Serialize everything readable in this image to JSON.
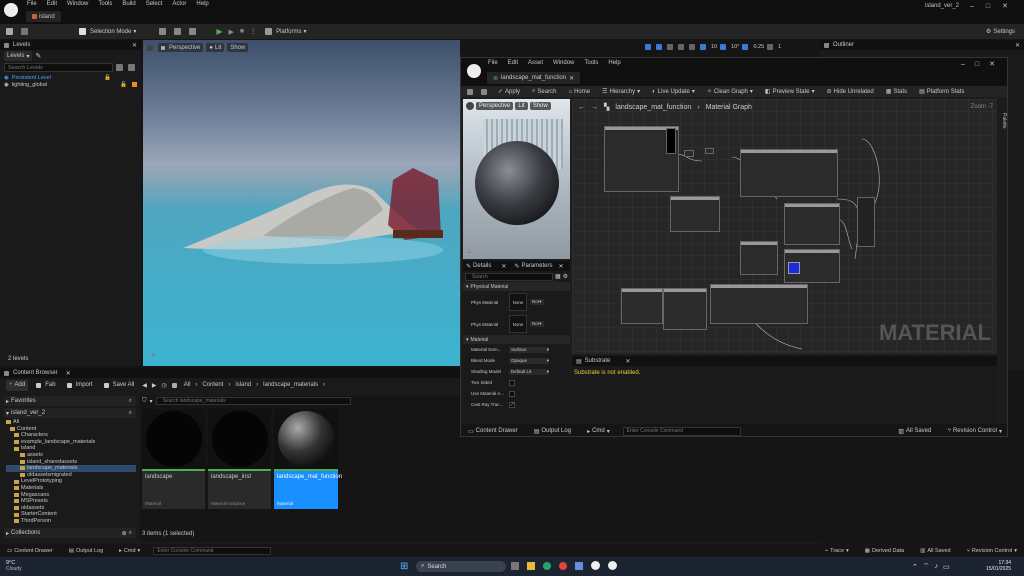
{
  "editor": {
    "menu": [
      "File",
      "Edit",
      "Window",
      "Tools",
      "Build",
      "Select",
      "Actor",
      "Help"
    ],
    "doc_tab": "island",
    "project_name": "island_ver_2",
    "toolbar": {
      "selection_mode": "Selection Mode",
      "platforms": "Platforms",
      "settings": "Settings"
    }
  },
  "levels": {
    "tab": "Levels",
    "dropdown": "Levels",
    "search_placeholder": "Search Levels",
    "items": [
      "Persistent Level",
      "lighting_global"
    ],
    "count": "2 levels"
  },
  "viewport": {
    "perspective": "Perspective",
    "lit": "Lit",
    "show": "Show",
    "grid": "10",
    "angle": "10°",
    "scale": "0.25",
    "cam": "1"
  },
  "outliner": {
    "tab": "Outliner"
  },
  "content_browser": {
    "tab": "Content Browser",
    "add": "Add",
    "fab": "Fab",
    "import": "Import",
    "save_all": "Save All",
    "breadcrumb": [
      "All",
      "Content",
      "island",
      "landscape_materials"
    ],
    "search_placeholder": "Search landscape_materials",
    "favorites": "Favorites",
    "project": "island_ver_2",
    "tree": [
      "All",
      "Content",
      "Characters",
      "example_landscape_materials",
      "island",
      "assets",
      "island_sharedassets",
      "landscape_materials",
      "oldassetsmigrated",
      "LevelPrototyping",
      "Materials",
      "Megascans",
      "MSPresets",
      "oldassets",
      "StarterContent",
      "ThirdPerson"
    ],
    "assets": [
      {
        "name": "landscape",
        "type": "Material"
      },
      {
        "name": "landscape_inst",
        "type": "Material Instance"
      },
      {
        "name": "landscape_mat_function",
        "type": "Material"
      }
    ],
    "status": "3 items (1 selected)",
    "collections": "Collections"
  },
  "material_editor": {
    "menu": [
      "File",
      "Edit",
      "Asset",
      "Window",
      "Tools",
      "Help"
    ],
    "tab": "landscape_mat_function",
    "toolbar": [
      "Apply",
      "Search",
      "Home",
      "Hierarchy",
      "Live Update",
      "Clean Graph",
      "Preview State",
      "Hide Unrelated",
      "Stats",
      "Platform Stats"
    ],
    "graph_breadcrumb": [
      "landscape_mat_function",
      "Material Graph"
    ],
    "zoom": "Zoom -7",
    "watermark": "MATERIAL",
    "palette": "Palette",
    "preview": {
      "perspective": "Perspective",
      "lit": "Lit",
      "show": "Show"
    },
    "details_tabs": [
      "Details",
      "Parameters"
    ],
    "search_placeholder": "Search",
    "physical_section": "Physical Material",
    "phys_rows": [
      {
        "label": "Phys Material",
        "value": "None",
        "drop": "Nor"
      },
      {
        "label": "Phys Material",
        "value": "None",
        "drop": "Nor"
      }
    ],
    "material_section": "Material",
    "mat_rows": [
      {
        "label": "Material Dom...",
        "value": "Surface"
      },
      {
        "label": "Blend Mode",
        "value": "Opaque"
      },
      {
        "label": "Shading Model",
        "value": "Default Lit"
      },
      {
        "label": "Two Sided",
        "value": ""
      },
      {
        "label": "Use Material A...",
        "value": ""
      },
      {
        "label": "Cast Ray Trac...",
        "value": ""
      }
    ],
    "substrate_tab": "Substrate",
    "substrate_msg": "Substrate is not enabled.",
    "bottom": {
      "content_drawer": "Content Drawer",
      "output_log": "Output Log",
      "cmd": "Cmd",
      "console_placeholder": "Enter Console Command",
      "all_saved": "All Saved",
      "revision": "Revision Control"
    }
  },
  "bottom_bar": {
    "content_drawer": "Content Drawer",
    "output_log": "Output Log",
    "cmd": "Cmd",
    "console_placeholder": "Enter Console Command",
    "trace": "Trace",
    "derived_data": "Derived Data",
    "all_saved": "All Saved",
    "revision": "Revision Control"
  },
  "taskbar": {
    "temp": "9°C",
    "weather": "Cloudy",
    "search": "Search",
    "time": "17:34",
    "date": "15/01/2025"
  }
}
